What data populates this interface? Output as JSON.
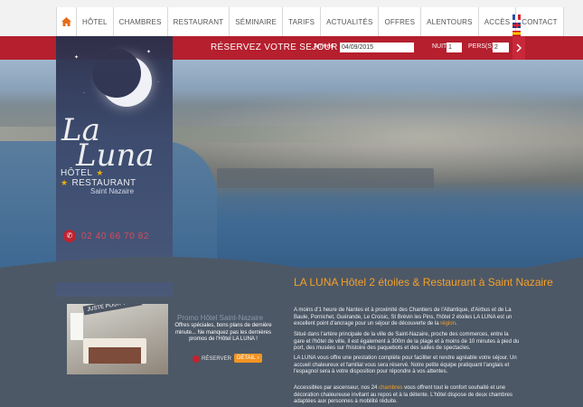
{
  "nav": {
    "home_icon": "home-icon",
    "items": [
      "HÔTEL",
      "CHAMBRES",
      "RESTAURANT",
      "SÉMINAIRE",
      "TARIFS",
      "ACTUALITÉS",
      "OFFRES",
      "ALENTOURS",
      "ACCÈS",
      "CONTACT"
    ],
    "languages": [
      "fr-flag",
      "en-flag",
      "es-flag"
    ]
  },
  "booking": {
    "title": "RÉSERVEZ VOTRE SEJOUR",
    "arrival_label": "Arrivée",
    "arrival_value": "04/09/2015",
    "nights_label": "NUIT(S)",
    "nights_value": "1",
    "persons_label": "PERS(S)",
    "persons_value": "2",
    "submit_icon": "chevron-right-icon"
  },
  "brand": {
    "logo_la": "La",
    "logo_luna": "Luna",
    "hotel": "HÔTEL",
    "stars": "★ ★",
    "restaurant": "RESTAURANT",
    "city": "Saint Nazaire",
    "phone": "02 40 66 70 82"
  },
  "main": {
    "title": "LA LUNA Hôtel 2 étoiles & Restaurant à Saint Nazaire",
    "p1_before": "A moins d'1 heure de Nantes et à proximité des Chantiers de l'Atlantique, d'Airbus et de La Baule, Pornichet, Guérande, Le Croisic, St Brévin les Pins, l'hôtel 2 étoiles LA LUNA est un excellent point d'ancrage pour un séjour de découverte de la ",
    "p1_link": "région",
    "p1_after": ".",
    "p2": "Situé dans l'artère principale de la ville de Saint-Nazaire, proche des commerces, entre la gare et l'hôtel de ville, il est également à 300m de la plage et à moins de 10 minutes à pied du port, des musées sur l'histoire des paquebots et des salles de spectacles.",
    "p3": "LA LUNA vous offre une prestation complète pour faciliter et rendre agréable votre séjour. Un accueil chaleureux et familial vous sera réservé. Notre petite équipe pratiquant l'anglais et l'espagnol sera à votre disposition pour répondre à vos attentes.",
    "p4_before": "Accessibles par ascenseur, nos 24 ",
    "p4_link": "chambres",
    "p4_after": " vous offrent tout le confort souhaité et une décoration chaleureuse invitant au repos et à la détente. L'hôtel dispose de deux chambres adaptées aux personnes à mobilité réduite."
  },
  "promo": {
    "ribbon": "JUSTE POUR VOUS",
    "title": "Promo Hôtel Saint-Nazaire",
    "text": "Offres spéciales, bons plans de dernière minute... Ne manquez pas les dernières promos de l'Hôtel LA LUNA !",
    "reserve_label": "RÉSERVER",
    "detail_label": "DÉTAIL"
  }
}
